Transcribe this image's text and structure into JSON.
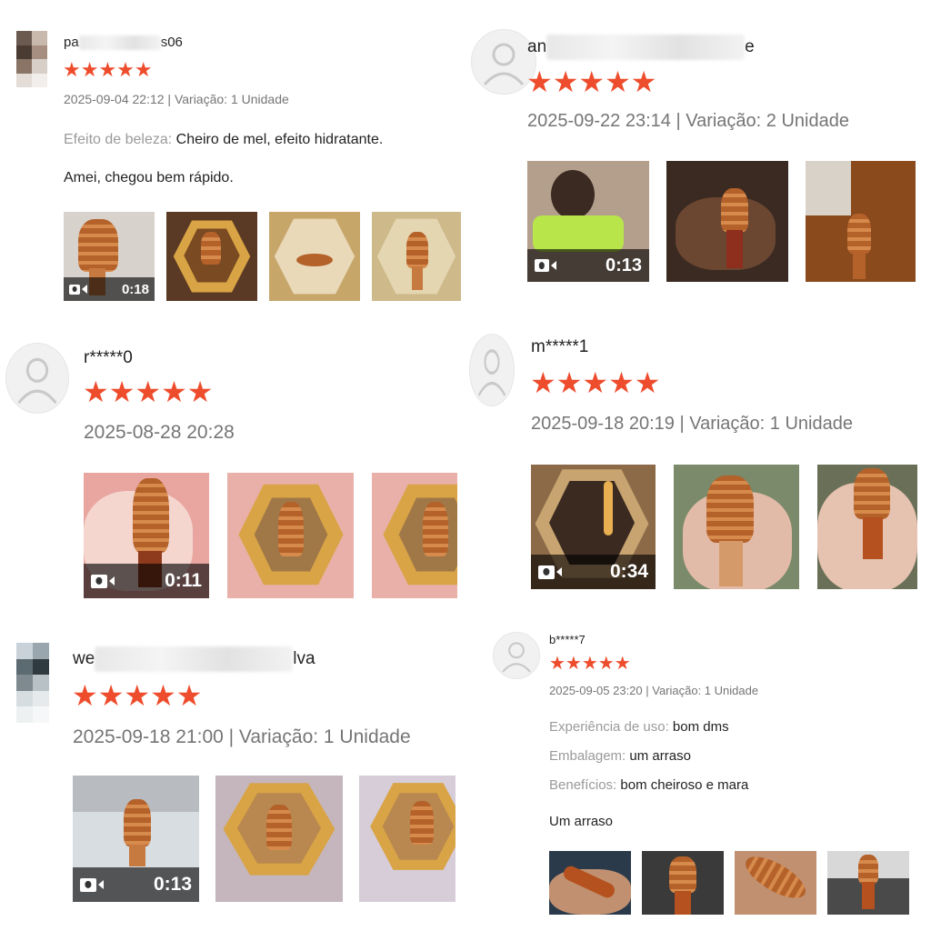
{
  "colors": {
    "star": "#ee4d2d",
    "meta": "#757575",
    "label": "#9a9a9a"
  },
  "reviews": [
    {
      "user": {
        "prefix": "pa",
        "suffix": "s06"
      },
      "stars": "★★★★★",
      "meta": "2025-09-04 22:12 | Variação: 1 Unidade",
      "lines": [
        {
          "label": "Efeito de beleza:",
          "value": " Cheiro de mel, efeito hidratante."
        }
      ],
      "comment": "Amei, chegou bem rápido.",
      "video_duration": "0:18"
    },
    {
      "user": {
        "prefix": "an",
        "suffix": "e"
      },
      "stars": "★★★★★",
      "meta": "2025-09-22 23:14 | Variação: 2 Unidade",
      "video_duration": "0:13"
    },
    {
      "user": {
        "name": "r*****0"
      },
      "stars": "★★★★★",
      "meta": "2025-08-28 20:28",
      "video_duration": "0:11"
    },
    {
      "user": {
        "name": "m*****1"
      },
      "stars": "★★★★★",
      "meta": "2025-09-18 20:19 | Variação: 1 Unidade",
      "video_duration": "0:34"
    },
    {
      "user": {
        "prefix": "we",
        "suffix": "lva"
      },
      "stars": "★★★★★",
      "meta": "2025-09-18 21:00 | Variação: 1 Unidade",
      "video_duration": "0:13"
    },
    {
      "user": {
        "name": "b*****7"
      },
      "stars": "★★★★★",
      "meta": "2025-09-05 23:20 | Variação: 1 Unidade",
      "lines": [
        {
          "label": "Experiência de uso:",
          "value": " bom dms"
        },
        {
          "label": "Embalagem:",
          "value": " um arraso"
        },
        {
          "label": "Benefícios:",
          "value": " bom cheiroso e mara"
        }
      ],
      "comment": "Um arraso"
    }
  ],
  "icons": {
    "avatar": "user-placeholder-icon",
    "video": "video-camera-icon",
    "star": "star-icon"
  }
}
